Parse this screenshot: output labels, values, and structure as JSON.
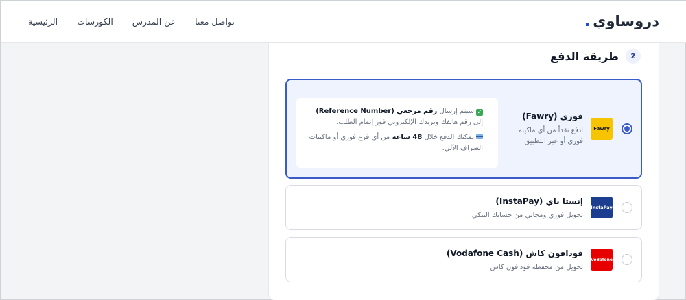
{
  "header": {
    "logo": "دروساوي",
    "nav": [
      "الرئيسية",
      "الكورسات",
      "عن المدرس",
      "تواصل معنا"
    ]
  },
  "section": {
    "step": "2",
    "title": "طريقة الدفع"
  },
  "options": [
    {
      "id": "fawry",
      "title": "فوري (Fawry)",
      "desc": "ادفع نقداً من أي ماكينة فوري أو عبر التطبيق",
      "logo_text": "Fawry",
      "selected": true,
      "info": {
        "line1_a": "سيتم إرسال ",
        "line1_b": "رقم مرجعي (Reference Number)",
        "line1_c": " إلى رقم هاتفك وبريدك الإلكتروني فور إتمام الطلب.",
        "line2_a": "يمكنك الدفع خلال ",
        "line2_b": "48 ساعة",
        "line2_c": " من أي فرع فوري أو ماكينات الصراف الآلي."
      }
    },
    {
      "id": "instapay",
      "title": "إنستا باي (InstaPay)",
      "desc": "تحويل فوري ومجاني من حسابك البنكي",
      "logo_text": "InstaPay",
      "selected": false
    },
    {
      "id": "vodafone",
      "title": "فودافون كاش (Vodafone Cash)",
      "desc": "تحويل من محفظة فودافون كاش",
      "logo_text": "Vodafone",
      "selected": false
    }
  ],
  "colors": {
    "accent": "#3b5bc9",
    "fawry": "#f6c400",
    "instapay": "#1c3e8f",
    "vodafone": "#e60000"
  }
}
